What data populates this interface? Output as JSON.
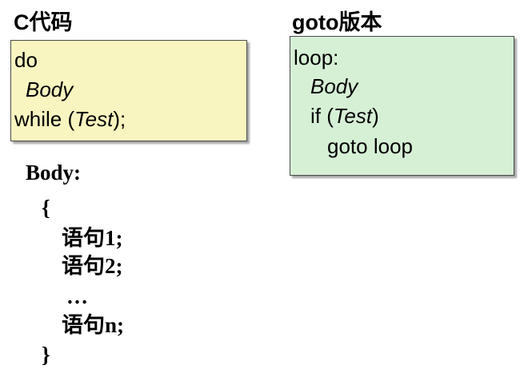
{
  "c_section": {
    "heading": "C代码",
    "lines": {
      "do": "do",
      "body": "Body",
      "while_prefix": "while (",
      "test": "Test",
      "while_suffix": ");"
    }
  },
  "goto_section": {
    "heading": "goto版本",
    "lines": {
      "loop": "loop:",
      "body": "Body",
      "if_prefix": "if (",
      "test": "Test",
      "if_suffix": ")",
      "goto": "goto loop"
    }
  },
  "body_section": {
    "label": "Body:",
    "open_brace": "{",
    "stmt1": "语句1;",
    "stmt2": "语句2;",
    "ellipsis": "…",
    "stmtn": "语句n;",
    "close_brace": "}"
  }
}
